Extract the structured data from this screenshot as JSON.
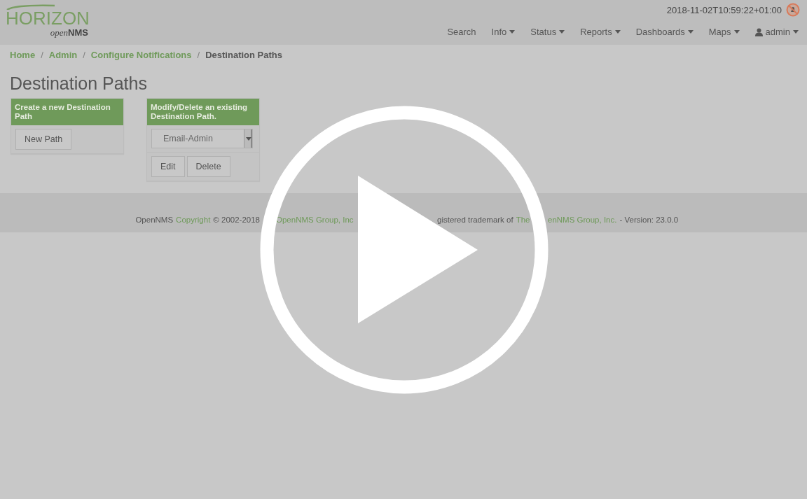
{
  "header": {
    "logo": {
      "title": "HORIZON",
      "subtitle_light": "open",
      "subtitle_bold": "NMS"
    },
    "timestamp": "2018-11-02T10:59:22+01:00",
    "nav": [
      {
        "label": "Search",
        "has_menu": false,
        "kind": "plain"
      },
      {
        "label": "Info",
        "has_menu": true,
        "kind": "plain"
      },
      {
        "label": "Status",
        "has_menu": true,
        "kind": "plain"
      },
      {
        "label": "Reports",
        "has_menu": true,
        "kind": "plain"
      },
      {
        "label": "Dashboards",
        "has_menu": true,
        "kind": "plain"
      },
      {
        "label": "Maps",
        "has_menu": true,
        "kind": "plain"
      },
      {
        "label": "admin",
        "has_menu": true,
        "kind": "user"
      }
    ]
  },
  "breadcrumb": {
    "separator": "/",
    "items": [
      {
        "label": "Home",
        "current": false
      },
      {
        "label": "Admin",
        "current": false
      },
      {
        "label": "Configure Notifications",
        "current": false
      },
      {
        "label": "Destination Paths",
        "current": true
      }
    ]
  },
  "page_title": "Destination Paths",
  "create_panel": {
    "heading": "Create a new Destination Path",
    "button": "New Path"
  },
  "modify_panel": {
    "heading": "Modify/Delete an existing Destination Path.",
    "select_value": "Email-Admin",
    "buttons": [
      "Edit",
      "Delete"
    ]
  },
  "footer": [
    {
      "text": "OpenNMS",
      "link": false
    },
    {
      "text": "Copyright",
      "link": true
    },
    {
      "text": "© 2002-2018",
      "link": false
    },
    {
      "text": "OpenNMS Group, Inc",
      "link": true
    },
    {
      "text": "gistered trademark of",
      "link": false
    },
    {
      "text": "The",
      "link": true
    },
    {
      "text": "enNMS Group, Inc.",
      "link": true
    },
    {
      "text": "- Version: 23.0.0",
      "link": false
    }
  ]
}
